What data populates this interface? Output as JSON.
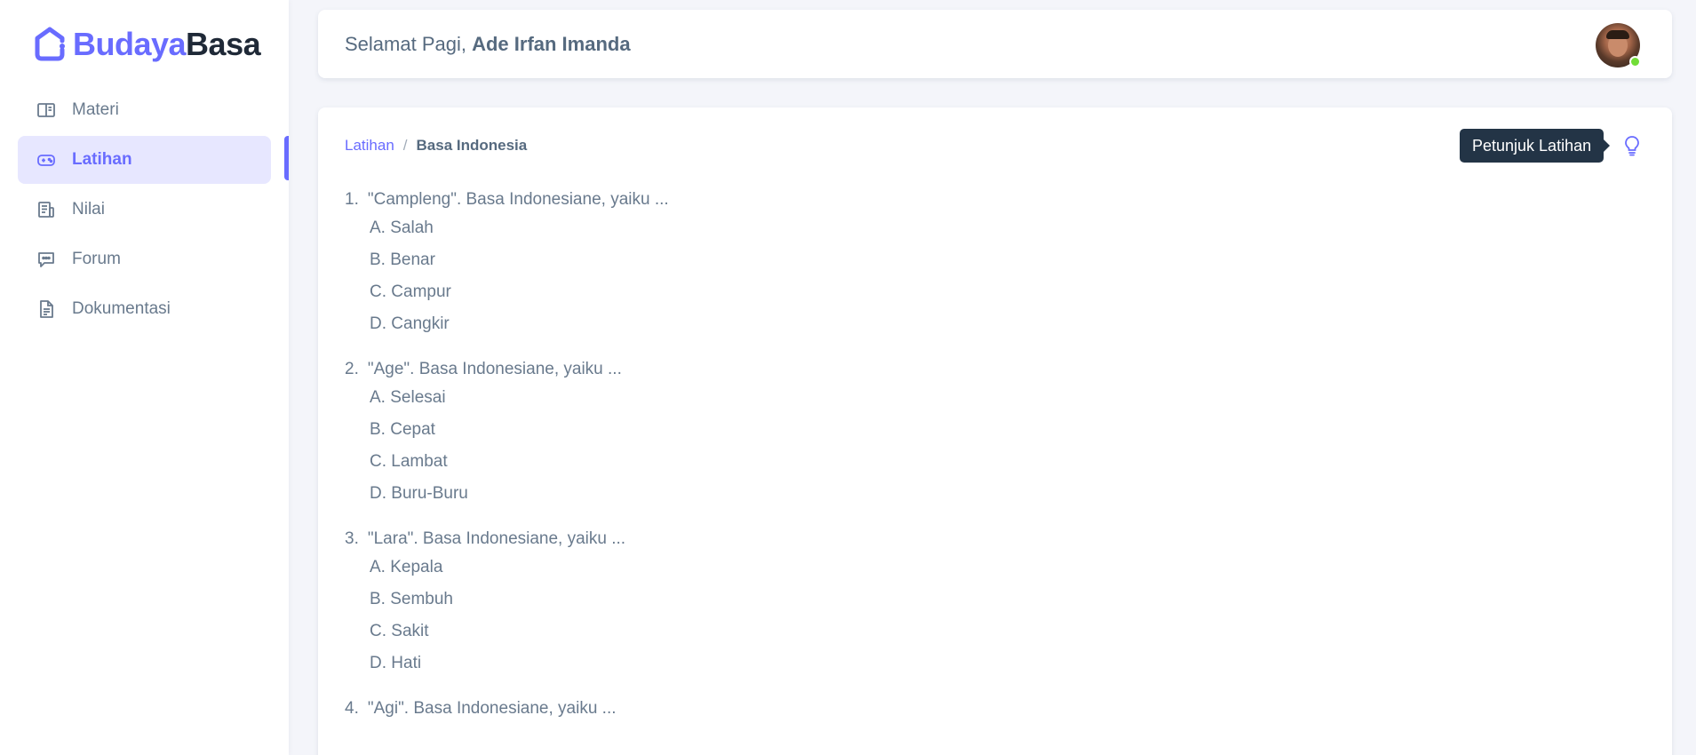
{
  "brand": {
    "part1": "Budaya",
    "part2": "Basa",
    "icon": "home-logo-icon",
    "accent": "#696cff"
  },
  "sidebar": {
    "items": [
      {
        "label": "Materi",
        "icon": "book-open-icon",
        "active": false
      },
      {
        "label": "Latihan",
        "icon": "gamepad-icon",
        "active": true
      },
      {
        "label": "Nilai",
        "icon": "report-icon",
        "active": false
      },
      {
        "label": "Forum",
        "icon": "chat-icon",
        "active": false
      },
      {
        "label": "Dokumentasi",
        "icon": "file-text-icon",
        "active": false
      }
    ]
  },
  "header": {
    "greeting": "Selamat Pagi,",
    "user_name": "Ade Irfan Imanda",
    "status": "online"
  },
  "breadcrumb": {
    "parent": "Latihan",
    "separator": "/",
    "current": "Basa Indonesia"
  },
  "hint": {
    "tooltip": "Petunjuk Latihan",
    "icon": "lightbulb-icon"
  },
  "questions": [
    {
      "number": "1.",
      "text": "\"Campleng\". Basa Indonesiane, yaiku ...",
      "options": [
        "A. Salah",
        "B. Benar",
        "C. Campur",
        "D. Cangkir"
      ]
    },
    {
      "number": "2.",
      "text": "\"Age\". Basa Indonesiane, yaiku ...",
      "options": [
        "A. Selesai",
        "B. Cepat",
        "C. Lambat",
        "D. Buru-Buru"
      ]
    },
    {
      "number": "3.",
      "text": "\"Lara\". Basa Indonesiane, yaiku ...",
      "options": [
        "A. Kepala",
        "B. Sembuh",
        "C. Sakit",
        "D. Hati"
      ]
    },
    {
      "number": "4.",
      "text": "\"Agi\". Basa Indonesiane, yaiku ...",
      "options": []
    }
  ]
}
